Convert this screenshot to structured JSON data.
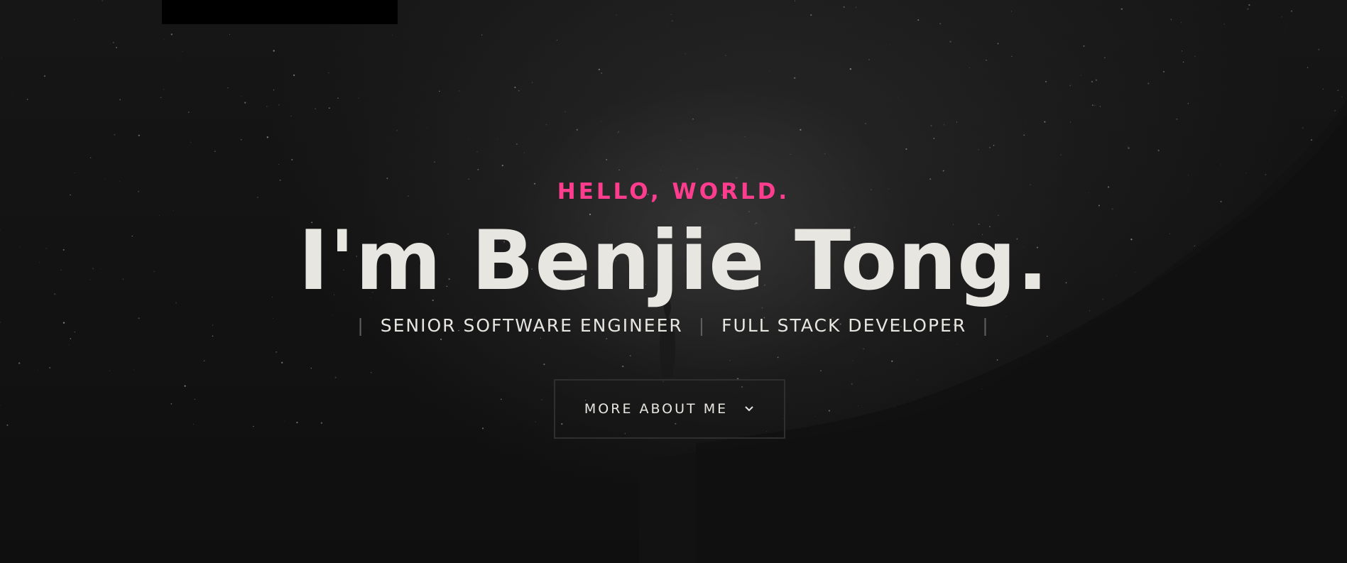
{
  "hero": {
    "kicker": "HELLO, WORLD.",
    "headline": "I'm Benjie Tong.",
    "roles": [
      "SENIOR SOFTWARE ENGINEER",
      "FULL STACK DEVELOPER"
    ],
    "separator": "|",
    "cta_label": "MORE ABOUT ME",
    "cta_icon": "chevron-down-icon"
  },
  "colors": {
    "accent": "#ff3d8f",
    "text": "#e8e6e1",
    "background": "#0f0f0f"
  }
}
